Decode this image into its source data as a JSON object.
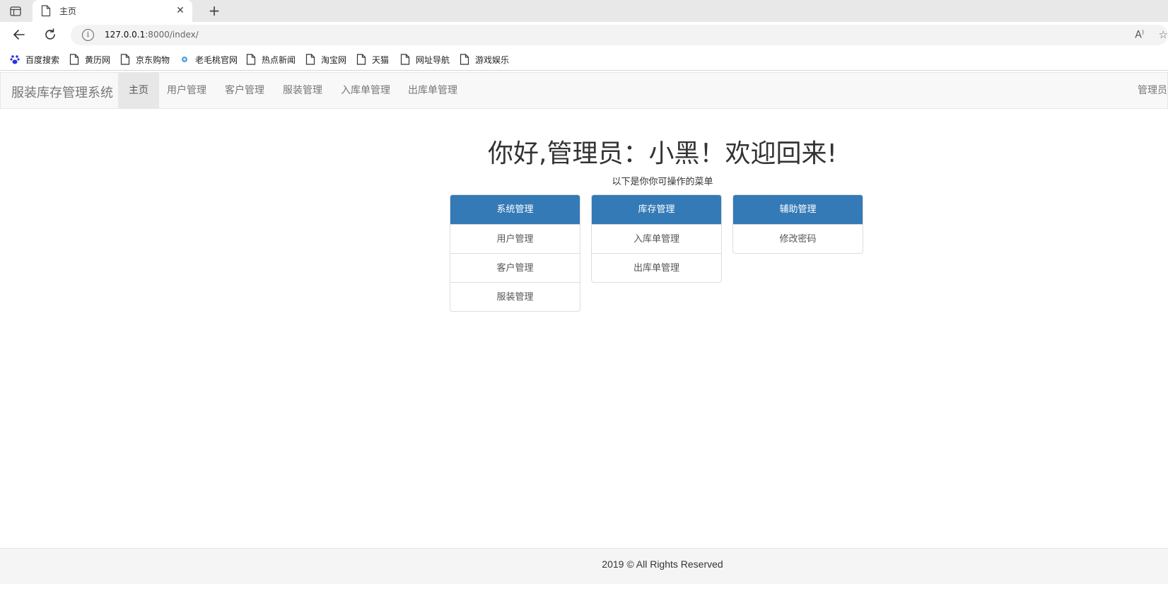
{
  "browser": {
    "tab_title": "主页",
    "url_host": "127.0.0.1",
    "url_rest": ":8000/index/",
    "bookmarks": [
      {
        "label": "百度搜索",
        "icon": "baidu-paw-icon"
      },
      {
        "label": "黄历网",
        "icon": "page-icon"
      },
      {
        "label": "京东购物",
        "icon": "page-icon"
      },
      {
        "label": "老毛桃官网",
        "icon": "globe-dot-icon"
      },
      {
        "label": "热点新闻",
        "icon": "page-icon"
      },
      {
        "label": "淘宝网",
        "icon": "page-icon"
      },
      {
        "label": "天猫",
        "icon": "page-icon"
      },
      {
        "label": "网址导航",
        "icon": "page-icon"
      },
      {
        "label": "游戏娱乐",
        "icon": "page-icon"
      }
    ]
  },
  "navbar": {
    "brand": "服装库存管理系统",
    "items": [
      "主页",
      "用户管理",
      "客户管理",
      "服装管理",
      "入库单管理",
      "出库单管理"
    ],
    "active_index": 0,
    "right_label": "管理员"
  },
  "main": {
    "welcome": "你好,管理员：小黑！欢迎回来!",
    "subtitle": "以下是你你可操作的菜单",
    "panels": [
      {
        "title": "系统管理",
        "items": [
          "用户管理",
          "客户管理",
          "服装管理"
        ]
      },
      {
        "title": "库存管理",
        "items": [
          "入库单管理",
          "出库单管理"
        ]
      },
      {
        "title": "辅助管理",
        "items": [
          "修改密码"
        ]
      }
    ]
  },
  "footer": {
    "text": "2019 © All Rights Reserved"
  },
  "colors": {
    "panel_header": "#337ab7",
    "navbar_bg": "#f8f8f8",
    "footer_bg": "#f5f5f5"
  }
}
